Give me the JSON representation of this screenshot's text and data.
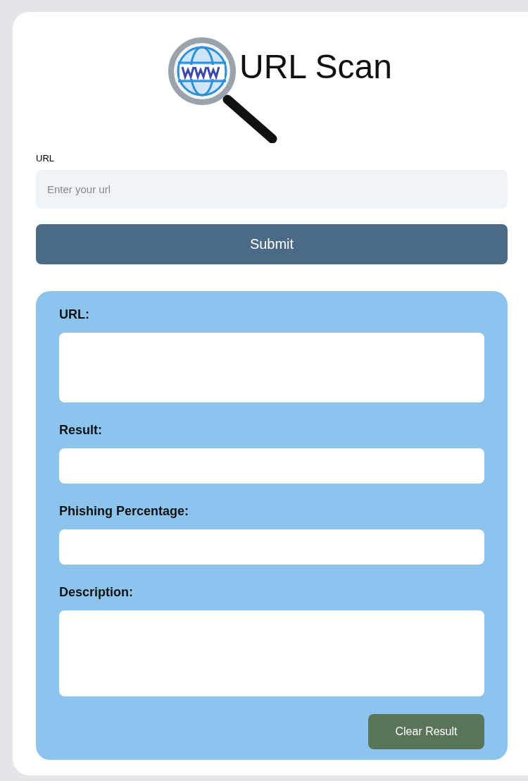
{
  "header": {
    "title": "URL Scan"
  },
  "url_field": {
    "label": "URL",
    "placeholder": "Enter your url"
  },
  "submit_button": "Submit",
  "results": {
    "fields": [
      {
        "label": "URL:",
        "kind": "area"
      },
      {
        "label": "Result:",
        "kind": "line"
      },
      {
        "label": "Phishing Percentage:",
        "kind": "line"
      },
      {
        "label": "Description:",
        "kind": "tall"
      }
    ],
    "clear_button": "Clear Result"
  }
}
